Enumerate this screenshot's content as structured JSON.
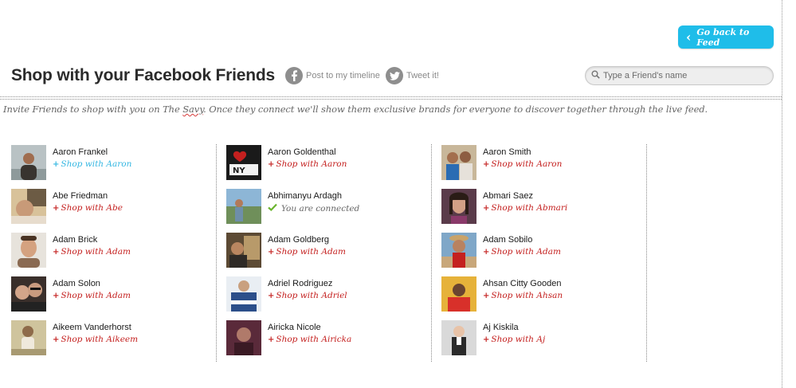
{
  "header": {
    "back_button": "Go back to Feed",
    "title": "Shop with your Facebook Friends",
    "post_label": "Post to my timeline",
    "tweet_label": "Tweet it!",
    "search_placeholder": "Type a Friend's name"
  },
  "invite": {
    "before": "Invite Friends to shop with you on The ",
    "brand": "Savy",
    "after": ". Once they connect we'll show them exclusive brands for everyone to discover together through the live feed."
  },
  "columns": [
    [
      {
        "name": "Aaron Frankel",
        "action": "Shop with Aaron",
        "state": "hover"
      },
      {
        "name": "Abe Friedman",
        "action": "Shop with Abe",
        "state": "shop"
      },
      {
        "name": "Adam Brick",
        "action": "Shop with Adam",
        "state": "shop"
      },
      {
        "name": "Adam Solon",
        "action": "Shop with Adam",
        "state": "shop"
      },
      {
        "name": "Aikeem Vanderhorst",
        "action": "Shop with Aikeem",
        "state": "shop"
      }
    ],
    [
      {
        "name": "Aaron Goldenthal",
        "action": "Shop with Aaron",
        "state": "shop"
      },
      {
        "name": "Abhimanyu Ardagh",
        "action": "You are connected",
        "state": "connected"
      },
      {
        "name": "Adam Goldberg",
        "action": "Shop with Adam",
        "state": "shop"
      },
      {
        "name": "Adriel Rodriguez",
        "action": "Shop with Adriel",
        "state": "shop"
      },
      {
        "name": "Airicka Nicole",
        "action": "Shop with Airicka",
        "state": "shop"
      }
    ],
    [
      {
        "name": "Aaron Smith",
        "action": "Shop with Aaron",
        "state": "shop"
      },
      {
        "name": "Abmari Saez",
        "action": "Shop with Abmari",
        "state": "shop"
      },
      {
        "name": "Adam Sobilo",
        "action": "Shop with Adam",
        "state": "shop"
      },
      {
        "name": "Ahsan Citty Gooden",
        "action": "Shop with Ahsan",
        "state": "shop"
      },
      {
        "name": "Aj Kiskila",
        "action": "Shop with Aj",
        "state": "shop"
      }
    ]
  ],
  "colors": {
    "accent_blue": "#1fbde9",
    "shop_red": "#c4201f",
    "hover_blue": "#35b7e2",
    "connected_green": "#6ab42d"
  }
}
